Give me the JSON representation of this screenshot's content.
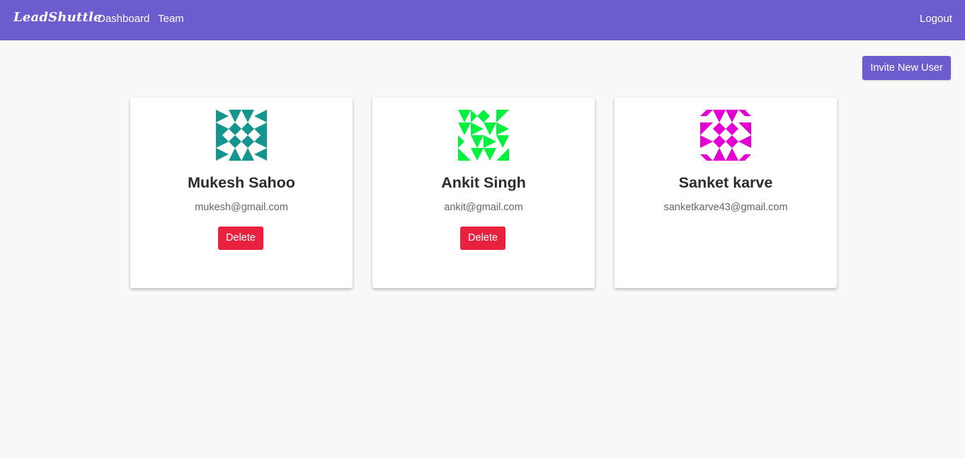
{
  "navbar": {
    "brand": "LeadShuttle",
    "links": [
      "Dashboard",
      "Team"
    ],
    "logout": "Logout",
    "color": "#6c5ccf"
  },
  "actions": {
    "invite_label": "Invite New User"
  },
  "team": {
    "members": [
      {
        "name": "Mukesh Sahoo",
        "email": "mukesh@gmail.com",
        "delete_label": "Delete",
        "avatar_color": "#14958f",
        "avatar_icon": "identicon-avatar"
      },
      {
        "name": "Ankit Singh",
        "email": "ankit@gmail.com",
        "delete_label": "Delete",
        "avatar_color": "#00f23e",
        "avatar_icon": "identicon-avatar"
      },
      {
        "name": "Sanket karve",
        "email": "sanketkarve43@gmail.com",
        "avatar_color": "#e400d4",
        "avatar_icon": "identicon-avatar"
      }
    ]
  },
  "colors": {
    "delete_button": "#e8213f",
    "background": "#f9f9f9"
  }
}
